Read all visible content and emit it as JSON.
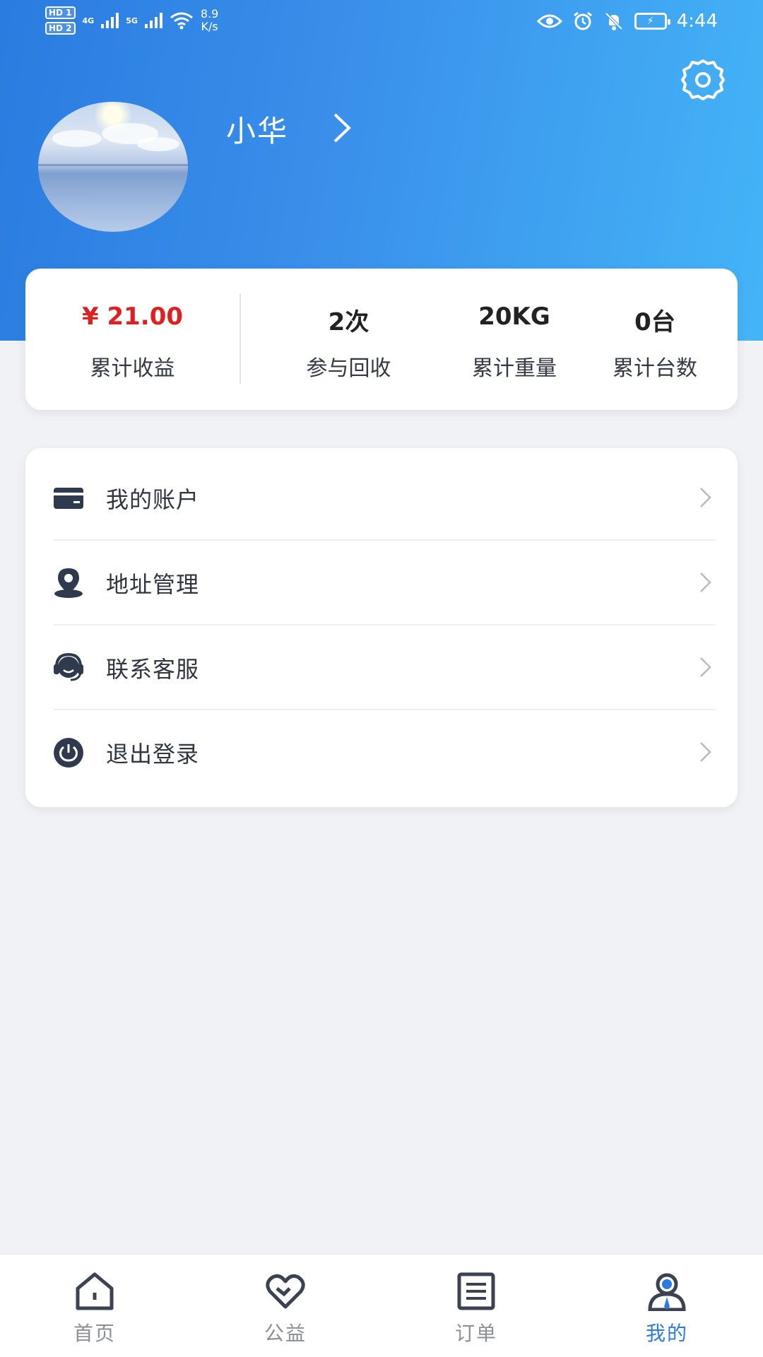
{
  "status_bar": {
    "sim1": "HD 1",
    "sim2": "HD 2",
    "net1": "4G",
    "net2": "5G",
    "speed_value": "8.9",
    "speed_unit": "K/s",
    "time": "4:44",
    "icons": [
      "eye-icon",
      "alarm-icon",
      "bell-off-icon",
      "battery-charging-icon"
    ]
  },
  "profile": {
    "username": "小华",
    "settings_icon": "gear-icon"
  },
  "stats": [
    {
      "value": "¥ 21.00",
      "label": "累计收益",
      "highlight": "#e02020"
    },
    {
      "value": "2次",
      "label": "参与回收"
    },
    {
      "value": "20KG",
      "label": "累计重量"
    },
    {
      "value": "0台",
      "label": "累计台数"
    }
  ],
  "menu": [
    {
      "label": "我的账户",
      "icon": "card-icon"
    },
    {
      "label": "地址管理",
      "icon": "location-icon"
    },
    {
      "label": "联系客服",
      "icon": "headset-icon"
    },
    {
      "label": "退出登录",
      "icon": "power-icon"
    }
  ],
  "tabbar": {
    "active_color": "#2c7be5",
    "items": [
      {
        "label": "首页",
        "icon": "home-icon"
      },
      {
        "label": "公益",
        "icon": "heart-icon"
      },
      {
        "label": "订单",
        "icon": "list-icon"
      },
      {
        "label": "我的",
        "icon": "user-icon",
        "active": true
      }
    ]
  },
  "colors": {
    "header_start": "#2a7ce0",
    "header_end": "#44b4f8",
    "background": "#f1f2f5",
    "income_red": "#e02020"
  }
}
